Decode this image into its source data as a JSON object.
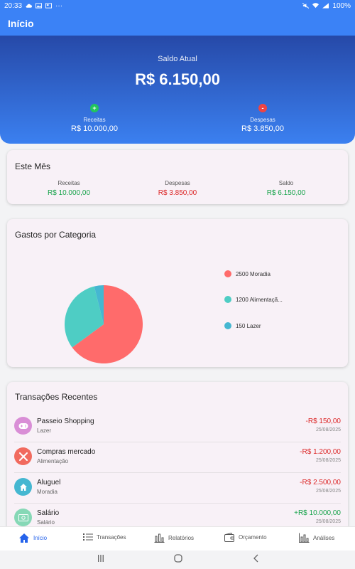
{
  "status_bar": {
    "time": "20:33",
    "more": "···",
    "battery": "100%"
  },
  "app_bar": {
    "title": "Início"
  },
  "balance": {
    "label": "Saldo Atual",
    "value": "R$ 6.150,00",
    "income": {
      "label": "Receitas",
      "value": "R$ 10.000,00",
      "icon": "+"
    },
    "expense": {
      "label": "Despesas",
      "value": "R$ 3.850,00",
      "icon": "-"
    }
  },
  "month_summary": {
    "title": "Este Mês",
    "income": {
      "label": "Receitas",
      "value": "R$ 10.000,00"
    },
    "expense": {
      "label": "Despesas",
      "value": "R$ 3.850,00"
    },
    "balance": {
      "label": "Saldo",
      "value": "R$ 6.150,00"
    }
  },
  "category_chart": {
    "title": "Gastos por Categoria",
    "legend": [
      {
        "label": "2500 Moradia",
        "color": "#ff6b6b"
      },
      {
        "label": "1200 Alimentaçã...",
        "color": "#4ecdc4"
      },
      {
        "label": "150 Lazer",
        "color": "#45b7d1"
      }
    ]
  },
  "chart_data": {
    "type": "pie",
    "categories": [
      "Moradia",
      "Alimentação",
      "Lazer"
    ],
    "values": [
      2500,
      1200,
      150
    ],
    "colors": [
      "#ff6b6b",
      "#4ecdc4",
      "#45b7d1"
    ],
    "legend_position": "right"
  },
  "transactions": {
    "title": "Transações Recentes",
    "items": [
      {
        "name": "Passeio Shopping",
        "category": "Lazer",
        "amount": "-R$ 150,00",
        "date": "25/08/2025",
        "type": "expense",
        "icon": "gamepad-icon",
        "color": "#d98ed6"
      },
      {
        "name": "Compras mercado",
        "category": "Alimentação",
        "amount": "-R$ 1.200,00",
        "date": "25/08/2025",
        "type": "expense",
        "icon": "utensils-icon",
        "color": "#f16a5e"
      },
      {
        "name": "Aluguel",
        "category": "Moradia",
        "amount": "-R$ 2.500,00",
        "date": "25/08/2025",
        "type": "expense",
        "icon": "home-icon",
        "color": "#45b7d1"
      },
      {
        "name": "Salário",
        "category": "Salário",
        "amount": "+R$ 10.000,00",
        "date": "25/08/2025",
        "type": "income",
        "icon": "money-icon",
        "color": "#86d8b6"
      }
    ]
  },
  "bottom_nav": {
    "items": [
      {
        "label": "Início",
        "icon": "home-icon",
        "active": true
      },
      {
        "label": "Transações",
        "icon": "list-icon"
      },
      {
        "label": "Relatórios",
        "icon": "bar-chart-icon"
      },
      {
        "label": "Orçamento",
        "icon": "wallet-icon"
      },
      {
        "label": "Análises",
        "icon": "analytics-icon"
      }
    ]
  },
  "colors": {
    "primary": "#3b82f6",
    "income": "#16a34a",
    "expense": "#dc2626"
  }
}
